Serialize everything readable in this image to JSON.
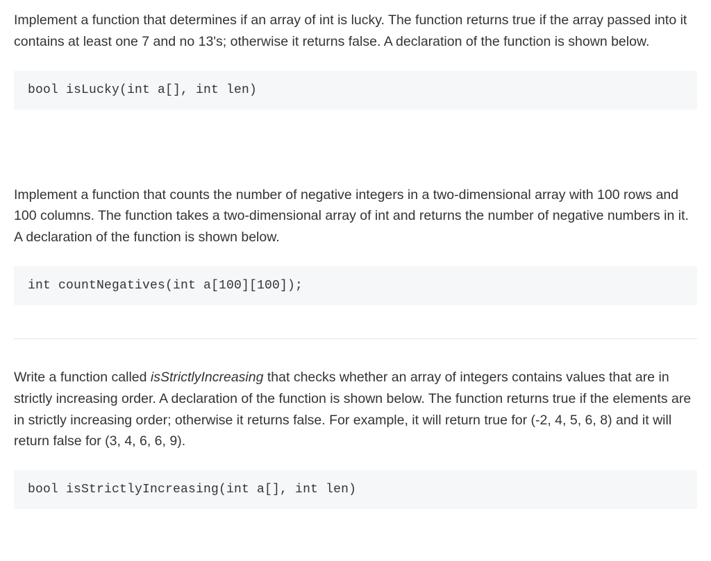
{
  "problems": [
    {
      "text_parts": [
        "Implement a function that determines if an array of int is lucky. The function returns true if the array passed into it contains at least one 7 and no 13's; otherwise it returns false. A declaration of the function is shown below."
      ],
      "code": "bool isLucky(int a[], int len)"
    },
    {
      "text_parts": [
        "Implement a function that counts the number of negative integers in a two-dimensional array with 100 rows and 100 columns. The function takes a two-dimensional array of int and returns the number of negative numbers in it. A declaration of the function is shown below."
      ],
      "code": "int countNegatives(int a[100][100]);"
    },
    {
      "text_before_italic": "Write a function called ",
      "text_italic": "isStrictlyIncreasing",
      "text_after_italic": " that checks whether an array of integers contains values that are in strictly increasing order. A declaration of the function is shown below. The function returns true if the elements are in strictly increasing order; otherwise it returns false. For example, it will return true for (-2, 4, 5, 6, 8) and it will return false for (3, 4, 6, 6, 9).",
      "code": "bool isStrictlyIncreasing(int a[], int len)"
    }
  ]
}
